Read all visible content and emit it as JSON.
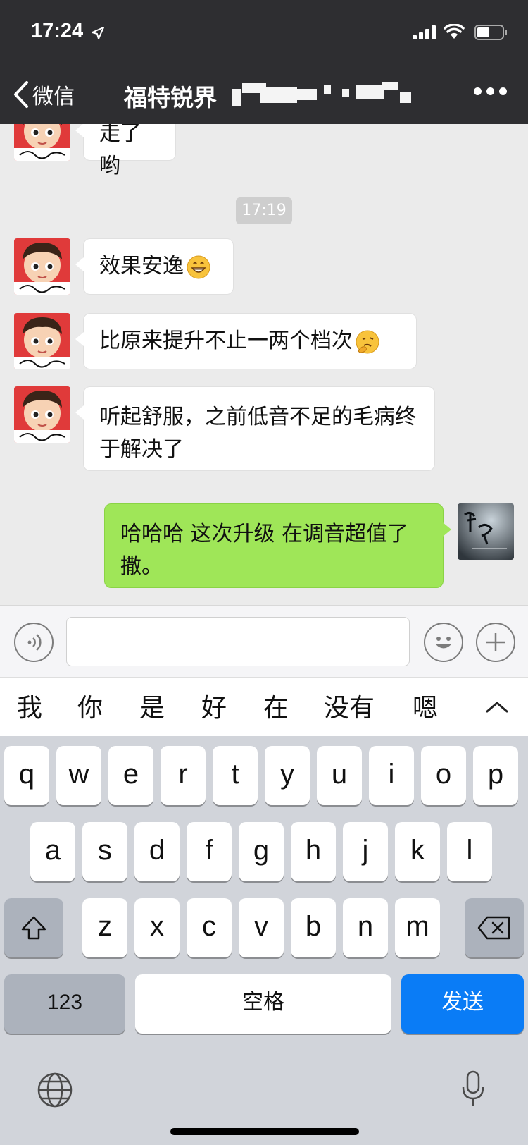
{
  "status_bar": {
    "time": "17:24"
  },
  "nav": {
    "back_label": "微信",
    "title": "福特锐界"
  },
  "messages": [
    {
      "side": "in",
      "text": "走了哟"
    },
    {
      "type": "time",
      "text": "17:19"
    },
    {
      "side": "in",
      "text": "效果安逸",
      "emoji": "grinning-emoji"
    },
    {
      "side": "in",
      "text": "比原来提升不止一两个档次",
      "emoji": "thinking-emoji"
    },
    {
      "side": "in",
      "text": "听起舒服，之前低音不足的毛病终于解决了"
    },
    {
      "side": "out",
      "text": "哈哈哈 这次升级 在调音超值了撒。"
    }
  ],
  "suggestions": [
    "我",
    "你",
    "是",
    "好",
    "在",
    "没有",
    "嗯"
  ],
  "keyboard": {
    "row1": [
      "q",
      "w",
      "e",
      "r",
      "t",
      "y",
      "u",
      "i",
      "o",
      "p"
    ],
    "row2": [
      "a",
      "s",
      "d",
      "f",
      "g",
      "h",
      "j",
      "k",
      "l"
    ],
    "row3": [
      "z",
      "x",
      "c",
      "v",
      "b",
      "n",
      "m"
    ],
    "numbers_key": "123",
    "space_key": "空格",
    "send_key": "发送"
  },
  "colors": {
    "outgoing_bubble": "#9fe658",
    "send_key": "#0a7cf6",
    "nav_bg": "#2e2e31"
  }
}
